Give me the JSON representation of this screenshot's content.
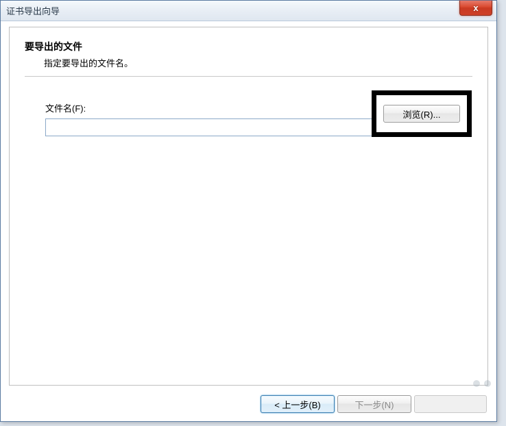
{
  "window": {
    "title": "证书导出向导"
  },
  "page": {
    "heading": "要导出的文件",
    "subheading": "指定要导出的文件名。"
  },
  "form": {
    "filename_label": "文件名(F):",
    "filename_value": "",
    "browse_label": "浏览(R)..."
  },
  "footer": {
    "back_label": "< 上一步(B)",
    "next_label": "下一步(N)"
  },
  "icons": {
    "close": "x"
  }
}
